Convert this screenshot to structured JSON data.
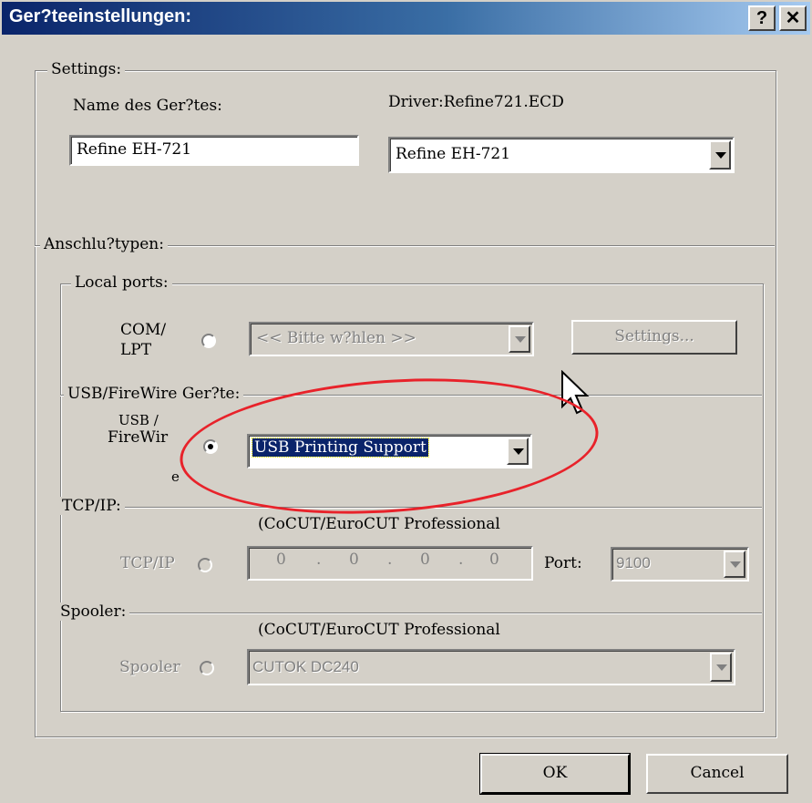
{
  "window": {
    "title": "Ger?teeinstellungen:",
    "help_button": "?",
    "close_button": "✕"
  },
  "settings": {
    "legend": "Settings:",
    "device_name_label": "Name des Ger?tes:",
    "device_name_value": "Refine EH-721",
    "driver_label": "Driver:Refine721.ECD",
    "driver_value": "Refine EH-721"
  },
  "connection": {
    "legend": "Anschlu?typen:",
    "local_ports": {
      "legend": "Local ports:",
      "com_lpt_label_line1": "COM/",
      "com_lpt_label_line2": "LPT",
      "port_select": "<< Bitte w?hlen >>",
      "settings_button": "Settings..."
    },
    "usb": {
      "legend": "USB/FireWire Ger?te:",
      "label_line1": "USB /",
      "label_line2": "FireWir",
      "label_line3": "e",
      "selected_device": "USB Printing Support"
    },
    "tcpip": {
      "legend": "TCP/IP:",
      "note": "(CoCUT/EuroCUT Professional",
      "radio_label": "TCP/IP",
      "ip_parts": [
        "0",
        "0",
        "0",
        "0"
      ],
      "port_label": "Port:",
      "port_value": "9100"
    },
    "spooler": {
      "legend": "Spooler:",
      "note": "(CoCUT/EuroCUT Professional",
      "radio_label": "Spooler",
      "printer": "CUTOK DC240"
    }
  },
  "buttons": {
    "ok": "OK",
    "cancel": "Cancel"
  },
  "annotation": {
    "color": "#e8222a"
  }
}
